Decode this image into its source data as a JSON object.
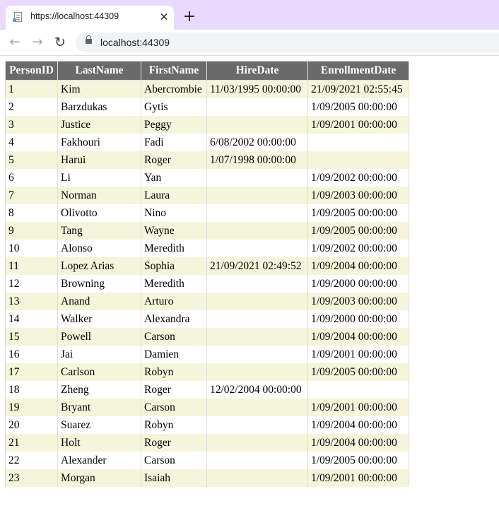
{
  "browser": {
    "tab": {
      "title": "https://localhost:44309",
      "close_icon": "close-icon",
      "favicon": "document-icon"
    },
    "new_tab_icon": "plus-icon",
    "toolbar": {
      "back_icon": "arrow-left-icon",
      "forward_icon": "arrow-right-icon",
      "reload_icon": "reload-icon",
      "lock_icon": "lock-icon",
      "url": "localhost:44309"
    },
    "colors": {
      "tabstrip": "#e9d9ff",
      "header_bg": "#6a6a6a",
      "row_alt": "#f5f5dc"
    }
  },
  "table": {
    "columns": [
      "PersonID",
      "LastName",
      "FirstName",
      "HireDate",
      "EnrollmentDate"
    ],
    "rows": [
      [
        "1",
        "Kim",
        "Abercrombie",
        "11/03/1995 00:00:00",
        "21/09/2021 02:55:45"
      ],
      [
        "2",
        "Barzdukas",
        "Gytis",
        "",
        "1/09/2005 00:00:00"
      ],
      [
        "3",
        "Justice",
        "Peggy",
        "",
        "1/09/2001 00:00:00"
      ],
      [
        "4",
        "Fakhouri",
        "Fadi",
        "6/08/2002 00:00:00",
        ""
      ],
      [
        "5",
        "Harui",
        "Roger",
        "1/07/1998 00:00:00",
        ""
      ],
      [
        "6",
        "Li",
        "Yan",
        "",
        "1/09/2002 00:00:00"
      ],
      [
        "7",
        "Norman",
        "Laura",
        "",
        "1/09/2003 00:00:00"
      ],
      [
        "8",
        "Olivotto",
        "Nino",
        "",
        "1/09/2005 00:00:00"
      ],
      [
        "9",
        "Tang",
        "Wayne",
        "",
        "1/09/2005 00:00:00"
      ],
      [
        "10",
        "Alonso",
        "Meredith",
        "",
        "1/09/2002 00:00:00"
      ],
      [
        "11",
        "Lopez Arias",
        "Sophia",
        "21/09/2021 02:49:52",
        "1/09/2004 00:00:00"
      ],
      [
        "12",
        "Browning",
        "Meredith",
        "",
        "1/09/2000 00:00:00"
      ],
      [
        "13",
        "Anand",
        "Arturo",
        "",
        "1/09/2003 00:00:00"
      ],
      [
        "14",
        "Walker",
        "Alexandra",
        "",
        "1/09/2000 00:00:00"
      ],
      [
        "15",
        "Powell",
        "Carson",
        "",
        "1/09/2004 00:00:00"
      ],
      [
        "16",
        "Jai",
        "Damien",
        "",
        "1/09/2001 00:00:00"
      ],
      [
        "17",
        "Carlson",
        "Robyn",
        "",
        "1/09/2005 00:00:00"
      ],
      [
        "18",
        "Zheng",
        "Roger",
        "12/02/2004 00:00:00",
        ""
      ],
      [
        "19",
        "Bryant",
        "Carson",
        "",
        "1/09/2001 00:00:00"
      ],
      [
        "20",
        "Suarez",
        "Robyn",
        "",
        "1/09/2004 00:00:00"
      ],
      [
        "21",
        "Holt",
        "Roger",
        "",
        "1/09/2004 00:00:00"
      ],
      [
        "22",
        "Alexander",
        "Carson",
        "",
        "1/09/2005 00:00:00"
      ],
      [
        "23",
        "Morgan",
        "Isaiah",
        "",
        "1/09/2001 00:00:00"
      ]
    ]
  }
}
